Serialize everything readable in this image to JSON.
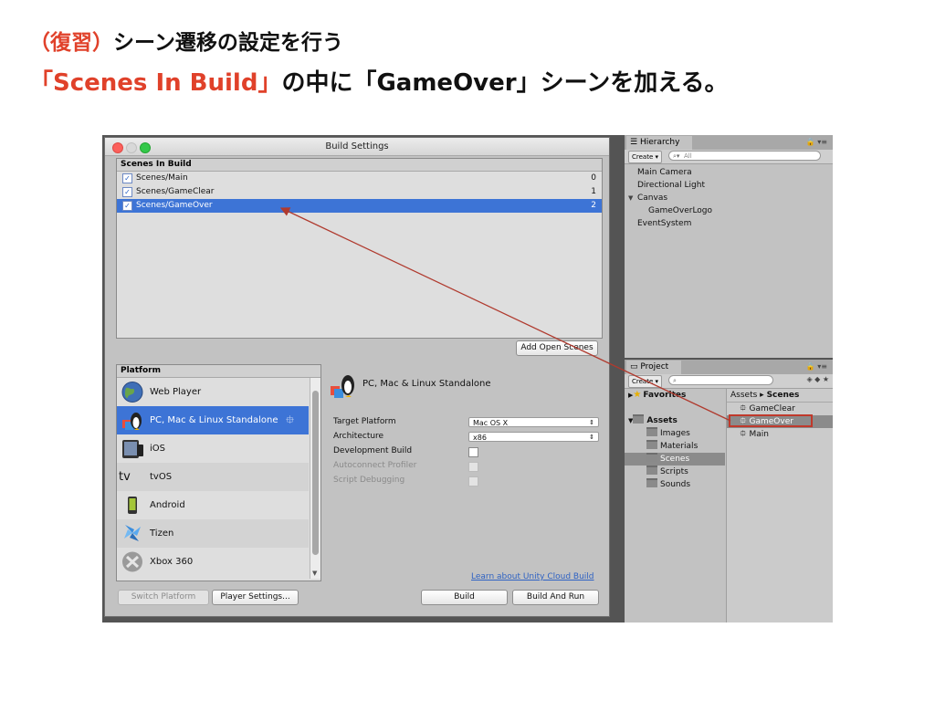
{
  "slide": {
    "line1_paren": "（復習）",
    "line1_rest": "シーン遷移の設定を行う",
    "line2_red": "「Scenes In Build」",
    "line2_rest": "の中に「GameOver」シーンを加える。"
  },
  "build_settings": {
    "title": "Build Settings",
    "scenes_header": "Scenes In Build",
    "scenes": [
      {
        "name": "Scenes/Main",
        "index": "0",
        "checked": true
      },
      {
        "name": "Scenes/GameClear",
        "index": "1",
        "checked": true
      },
      {
        "name": "Scenes/GameOver",
        "index": "2",
        "checked": true
      }
    ],
    "add_open_scenes": "Add Open Scenes",
    "platform_header": "Platform",
    "platforms": [
      {
        "label": "Web Player",
        "icon": "globe-icon"
      },
      {
        "label": "PC, Mac & Linux Standalone",
        "icon": "penguin-icon"
      },
      {
        "label": "iOS",
        "icon": "ios-device-icon"
      },
      {
        "label": "tvOS",
        "icon": "apple-tv-icon"
      },
      {
        "label": "Android",
        "icon": "android-icon"
      },
      {
        "label": "Tizen",
        "icon": "tizen-icon"
      },
      {
        "label": "Xbox 360",
        "icon": "xbox-icon"
      }
    ],
    "selected_platform_title": "PC, Mac & Linux Standalone",
    "target_platform_label": "Target Platform",
    "target_platform_value": "Mac OS X",
    "architecture_label": "Architecture",
    "architecture_value": "x86",
    "development_build_label": "Development Build",
    "autoconnect_profiler_label": "Autoconnect Profiler",
    "script_debugging_label": "Script Debugging",
    "cloud_build_link": "Learn about Unity Cloud Build",
    "switch_platform": "Switch Platform",
    "player_settings": "Player Settings...",
    "build": "Build",
    "build_and_run": "Build And Run"
  },
  "hierarchy": {
    "tab": "Hierarchy",
    "create": "Create",
    "search_placeholder": "All",
    "items": [
      "Main Camera",
      "Directional Light",
      "Canvas",
      "GameOverLogo",
      "EventSystem"
    ]
  },
  "project": {
    "tab": "Project",
    "create": "Create",
    "favorites": "Favorites",
    "assets": "Assets",
    "folders": [
      "Images",
      "Materials",
      "Scenes",
      "Scripts",
      "Sounds"
    ],
    "breadcrumb_root": "Assets",
    "breadcrumb_sep": "▸",
    "breadcrumb_leaf": "Scenes",
    "scene_files": [
      "GameClear",
      "GameOver",
      "Main"
    ]
  },
  "colors": {
    "accent_red": "#e0412a",
    "selection_blue": "#3d74d6",
    "arrow": "#c0392b"
  }
}
